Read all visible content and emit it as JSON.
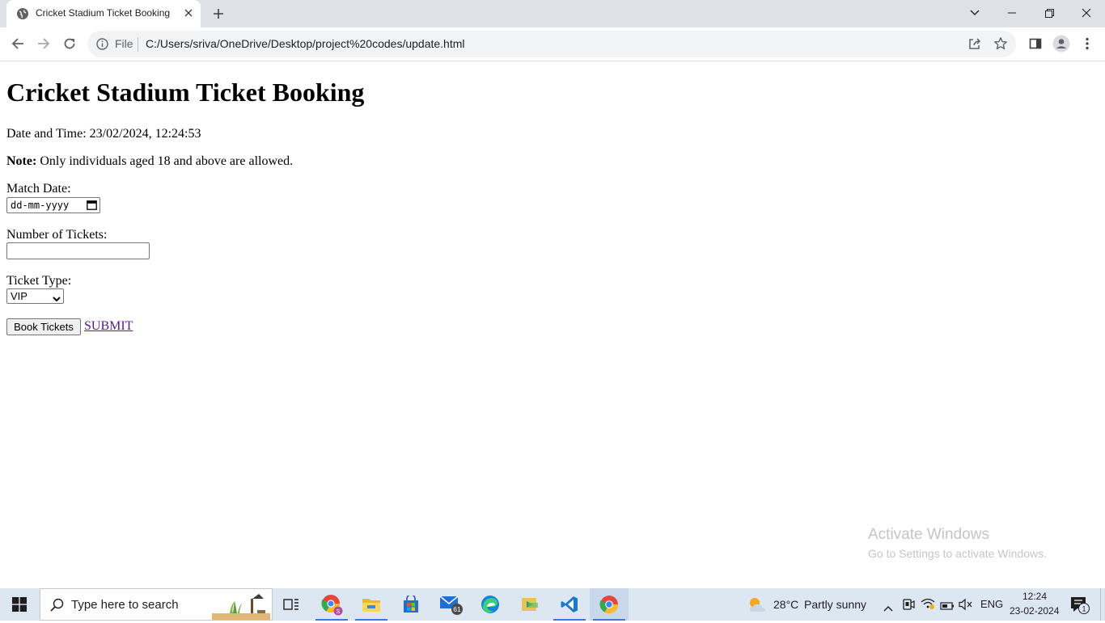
{
  "browser": {
    "tab_title": "Cricket Stadium Ticket Booking",
    "omnibox_scheme": "File",
    "url": "C:/Users/sriva/OneDrive/Desktop/project%20codes/update.html"
  },
  "page": {
    "heading": "Cricket Stadium Ticket Booking",
    "datetime_label": "Date and Time: ",
    "datetime_value": "23/02/2024, 12:24:53",
    "note_label": "Note:",
    "note_text": " Only individuals aged 18 and above are allowed.",
    "match_date_label": "Match Date:",
    "match_date_placeholder": "dd-mm-yyyy",
    "tickets_label": "Number of Tickets:",
    "tickets_value": "",
    "ticket_type_label": "Ticket Type:",
    "ticket_type_selected": "VIP",
    "book_button": "Book Tickets",
    "submit_link": "SUBMIT"
  },
  "watermark": {
    "title": "Activate Windows",
    "subtitle": "Go to Settings to activate Windows."
  },
  "taskbar": {
    "search_placeholder": "Type here to search",
    "mail_badge": "61",
    "weather_temp": "28°C",
    "weather_desc": "Partly sunny",
    "language": "ENG",
    "time": "12:24",
    "date": "23-02-2024",
    "notification_count": "1"
  },
  "icons": {
    "back": "arrow-left-icon",
    "forward": "arrow-right-icon",
    "reload": "reload-icon",
    "info": "info-icon",
    "share": "share-icon",
    "bookmark": "star-icon",
    "sidepanel": "side-panel-icon",
    "profile": "profile-icon",
    "menu": "kebab-menu-icon"
  },
  "colors": {
    "tabstrip": "#dee1e6",
    "link_visited": "#551a8b",
    "taskbar": "#dde7f2"
  }
}
